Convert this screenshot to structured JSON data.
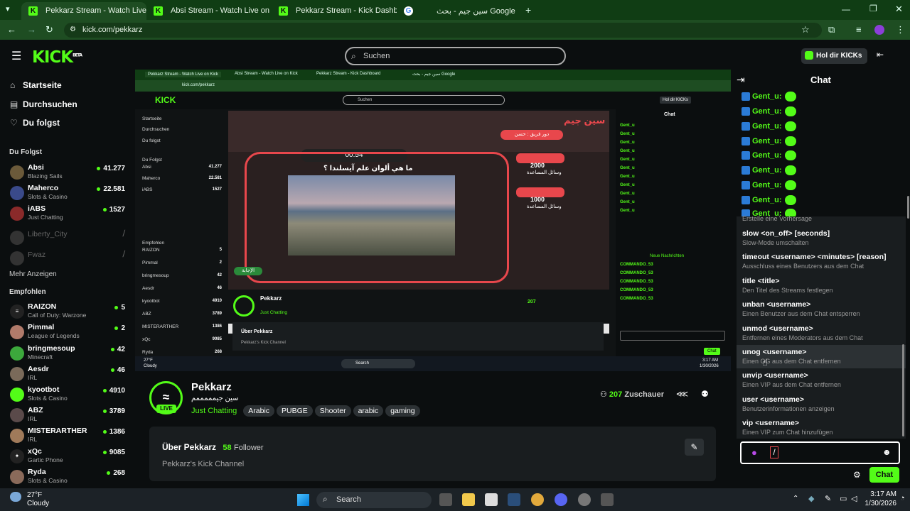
{
  "browser": {
    "tabs": [
      {
        "title": "Pekkarz Stream - Watch Live on Kick",
        "active": true
      },
      {
        "title": "Absi Stream - Watch Live on Kick",
        "active": false
      },
      {
        "title": "Pekkarz Stream - Kick Dashboard",
        "active": false
      },
      {
        "title": "سين جيم - بحث Google",
        "active": false
      }
    ],
    "url": "kick.com/pekkarz"
  },
  "topbar": {
    "logo": "KICK",
    "logo_sup": "BETA",
    "search_placeholder": "Suchen",
    "kicks_button": "Hol dir KICKs"
  },
  "sidebar": {
    "nav": [
      "Startseite",
      "Durchsuchen",
      "Du folgst"
    ],
    "following_header": "Du Folgst",
    "following": [
      {
        "name": "Absi",
        "category": "Blazing Sails",
        "viewers": "41.277",
        "live": true
      },
      {
        "name": "Maherco",
        "category": "Slots & Casino",
        "viewers": "22.581",
        "live": true
      },
      {
        "name": "iABS",
        "category": "Just Chatting",
        "viewers": "1527",
        "live": true
      },
      {
        "name": "Liberty_City",
        "category": "",
        "viewers": "",
        "live": false
      },
      {
        "name": "Fwaz",
        "category": "",
        "viewers": "",
        "live": false
      }
    ],
    "show_more": "Mehr Anzeigen",
    "recommended_header": "Empfohlen",
    "recommended": [
      {
        "name": "RAIZON",
        "category": "Call of Duty: Warzone",
        "viewers": "5"
      },
      {
        "name": "Pimmal",
        "category": "League of Legends",
        "viewers": "2"
      },
      {
        "name": "bringmesoup",
        "category": "Minecraft",
        "viewers": "42"
      },
      {
        "name": "Aesdr",
        "category": "IRL",
        "viewers": "46"
      },
      {
        "name": "kyootbot",
        "category": "Slots & Casino",
        "viewers": "4910"
      },
      {
        "name": "ABZ",
        "category": "IRL",
        "viewers": "3789"
      },
      {
        "name": "MISTERARTHER",
        "category": "IRL",
        "viewers": "1386"
      },
      {
        "name": "xQc",
        "category": "Gartic Phone",
        "viewers": "9085"
      },
      {
        "name": "Ryda",
        "category": "Slots & Casino",
        "viewers": "268"
      }
    ]
  },
  "player": {
    "game_question": "ما هي ألوان علم آيسلندا ؟",
    "timer": "00:54",
    "game_title": "سين جيم",
    "team_label": "دور فريق : حسن",
    "score_1": "2000",
    "score_2": "1000",
    "aids_label": "وسائل المساعدة",
    "answer_btn": "الإجابة",
    "mini_chat_header": "Chat",
    "mini_new_msgs": "Neue Nachrichten",
    "mini_chat_users": [
      "Gent_u",
      "COMMANDO_53"
    ]
  },
  "stream": {
    "streamer": "Pekkarz",
    "stream_title": "سين جيمممممم",
    "live_badge": "LIVE",
    "category": "Just Chatting",
    "tags": [
      "Arabic",
      "PUBGE",
      "Shooter",
      "arabic",
      "gaming"
    ],
    "viewers": "207",
    "viewers_label": "Zuschauer",
    "about_title": "Über Pekkarz",
    "followers": "58",
    "followers_label": "Follower",
    "about_text": "Pekkarz's Kick Channel"
  },
  "chat": {
    "title": "Chat",
    "messages": [
      {
        "user": "Gent_u:"
      },
      {
        "user": "Gent_u:"
      },
      {
        "user": "Gent_u:"
      },
      {
        "user": "Gent_u:"
      },
      {
        "user": "Gent_u:"
      },
      {
        "user": "Gent_u:"
      },
      {
        "user": "Gent_u:"
      },
      {
        "user": "Gent_u:"
      },
      {
        "user": "Gent_u:"
      }
    ],
    "partial_top": "Erstelle eine Vorhersage",
    "commands": [
      {
        "cmd": "slow <on_off> [seconds]",
        "desc": "Slow-Mode umschalten"
      },
      {
        "cmd": "timeout <username> <minutes> [reason]",
        "desc": "Ausschluss eines Benutzers aus dem Chat"
      },
      {
        "cmd": "title <title>",
        "desc": "Den Titel des Streams festlegen"
      },
      {
        "cmd": "unban <username>",
        "desc": "Einen Benutzer aus dem Chat entsperren"
      },
      {
        "cmd": "unmod <username>",
        "desc": "Entfernen eines Moderators aus dem Chat"
      },
      {
        "cmd": "unog <username>",
        "desc": "Einen OG aus dem Chat entfernen"
      },
      {
        "cmd": "unvip <username>",
        "desc": "Einen VIP aus dem Chat entfernen"
      },
      {
        "cmd": "user <username>",
        "desc": "Benutzerinformationen anzeigen"
      },
      {
        "cmd": "vip <username>",
        "desc": "Einen VIP zum Chat hinzufügen"
      }
    ],
    "input_value": "/",
    "send_button": "Chat"
  },
  "taskbar": {
    "weather_temp": "27°F",
    "weather_desc": "Cloudy",
    "search": "Search",
    "time": "3:17 AM",
    "date": "1/30/2026"
  },
  "colors": {
    "accent": "#53fc18",
    "bg": "#0b0e0f",
    "panel": "#191d1f",
    "tab_bar": "#103d14"
  }
}
